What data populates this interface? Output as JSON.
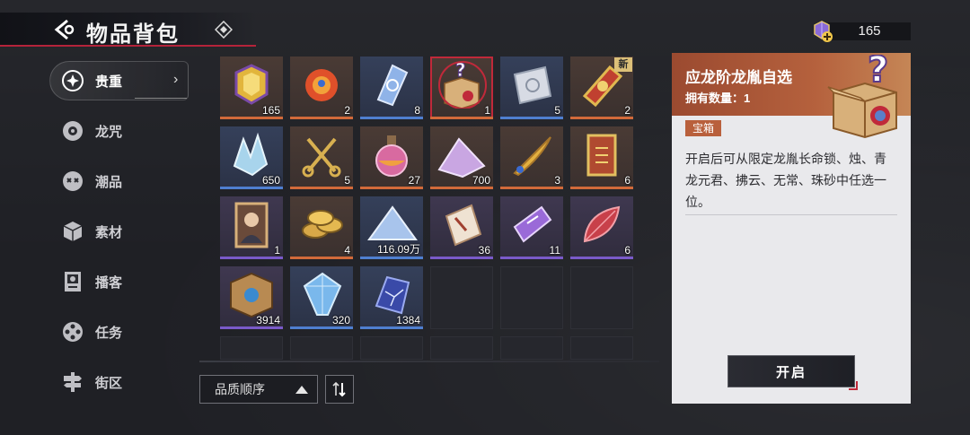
{
  "header": {
    "title": "物品背包"
  },
  "currency": {
    "value": "165",
    "icon": "crystal-plus-icon"
  },
  "sidebar": {
    "items": [
      {
        "label": "贵重",
        "icon": "star-badge-icon",
        "active": true
      },
      {
        "label": "龙咒",
        "icon": "disc-icon"
      },
      {
        "label": "潮品",
        "icon": "mask-icon"
      },
      {
        "label": "素材",
        "icon": "cube-icon"
      },
      {
        "label": "播客",
        "icon": "podcast-icon"
      },
      {
        "label": "任务",
        "icon": "film-reel-icon"
      },
      {
        "label": "街区",
        "icon": "street-sign-icon"
      }
    ]
  },
  "inventory": {
    "items": [
      {
        "name": "gold-gem-item",
        "qty": "165",
        "rarity": "orange"
      },
      {
        "name": "dragon-spirit-item",
        "qty": "2",
        "rarity": "orange"
      },
      {
        "name": "blue-crystal-shard-item",
        "qty": "8",
        "rarity": "blue"
      },
      {
        "name": "mystery-box-item",
        "qty": "1",
        "rarity": "orange",
        "selected": true
      },
      {
        "name": "silver-ticket-item",
        "qty": "5",
        "rarity": "blue"
      },
      {
        "name": "gold-ticket-item",
        "qty": "2",
        "rarity": "orange",
        "new_label": "新"
      },
      {
        "name": "ice-crystal-item",
        "qty": "650",
        "rarity": "blue"
      },
      {
        "name": "golden-scissors-item",
        "qty": "5",
        "rarity": "orange"
      },
      {
        "name": "potion-flask-item",
        "qty": "27",
        "rarity": "orange"
      },
      {
        "name": "purple-powder-item",
        "qty": "700",
        "rarity": "orange"
      },
      {
        "name": "golden-feather-item",
        "qty": "3",
        "rarity": "orange"
      },
      {
        "name": "ornate-card-item",
        "qty": "6",
        "rarity": "orange"
      },
      {
        "name": "portrait-card-item",
        "qty": "1",
        "rarity": "purple"
      },
      {
        "name": "coin-stack-item",
        "qty": "4",
        "rarity": "orange"
      },
      {
        "name": "blue-sand-item",
        "qty": "116.09万",
        "rarity": "blue"
      },
      {
        "name": "paper-ticket-item",
        "qty": "36",
        "rarity": "purple"
      },
      {
        "name": "purple-ticket-item",
        "qty": "11",
        "rarity": "purple"
      },
      {
        "name": "red-leaf-item",
        "qty": "6",
        "rarity": "purple"
      },
      {
        "name": "mechanical-cube-item",
        "qty": "3914",
        "rarity": "purple"
      },
      {
        "name": "blue-gem-item",
        "qty": "320",
        "rarity": "blue"
      },
      {
        "name": "cracked-crystal-item",
        "qty": "1384",
        "rarity": "blue"
      }
    ]
  },
  "sort": {
    "label": "品质顺序"
  },
  "detail": {
    "title": "应龙阶龙胤自选",
    "owned": "拥有数量：1",
    "tag": "宝箱",
    "description": "开启后可从限定龙胤长命锁、烛、青龙元君、拂云、无常、珠砂中任选一位。",
    "button": "开启"
  },
  "colors": {
    "accent_red": "#c0293a",
    "detail_header": "#b5613d",
    "rarity_orange": "#d26a3a",
    "rarity_purple": "#7a5ac9",
    "rarity_blue": "#4f7fd0"
  }
}
